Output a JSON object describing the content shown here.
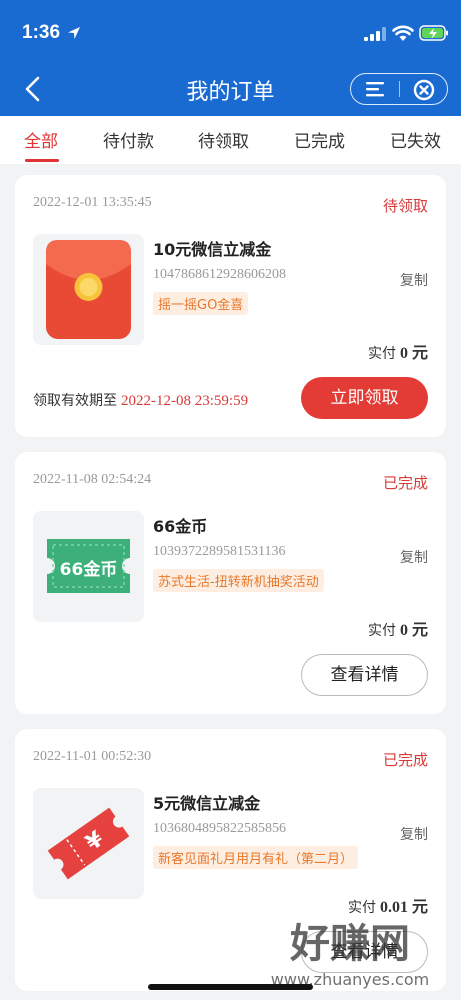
{
  "status_bar": {
    "time": "1:36"
  },
  "header": {
    "title": "我的订单"
  },
  "tabs": [
    {
      "label": "全部",
      "active": true
    },
    {
      "label": "待付款"
    },
    {
      "label": "待领取"
    },
    {
      "label": "已完成"
    },
    {
      "label": "已失效"
    }
  ],
  "orders": [
    {
      "date": "2022-12-01 13:35:45",
      "status": "待领取",
      "name": "10元微信立减金",
      "order_no": "1047868612928606208",
      "copy_label": "复制",
      "tag": "摇一摇GO金喜",
      "paid_label": "实付",
      "paid_amount": "0 元",
      "expire_label": "领取有效期至",
      "expire_date": "2022-12-08 23:59:59",
      "button": "立即领取",
      "icon": "red-envelope-icon"
    },
    {
      "date": "2022-11-08 02:54:24",
      "status": "已完成",
      "name": "66金币",
      "order_no": "1039372289581531136",
      "copy_label": "复制",
      "tag": "苏式生活-扭转新机抽奖活动",
      "paid_label": "实付",
      "paid_amount": "0 元",
      "button": "查看详情",
      "thumb_text": "66金币",
      "icon": "gold-coin-ticket-icon"
    },
    {
      "date": "2022-11-01 00:52:30",
      "status": "已完成",
      "name": "5元微信立减金",
      "order_no": "1036804895822585856",
      "copy_label": "复制",
      "tag": "新客见面礼月用月有礼（第二月）",
      "paid_label": "实付",
      "paid_amount": "0.01 元",
      "button": "查看详情",
      "icon": "yuan-coupon-icon"
    }
  ],
  "watermark": {
    "text": "好赚网",
    "url_text": "www.zhuanyes.com"
  },
  "colors": {
    "brand_blue": "#1a6bd1",
    "accent_red": "#e33b35",
    "tag_orange": "#e8782c"
  }
}
